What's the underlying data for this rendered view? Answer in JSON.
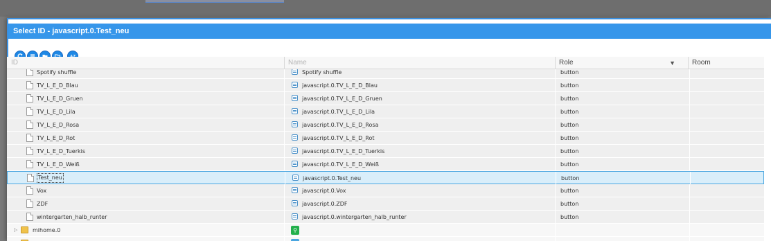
{
  "dialog": {
    "title": "Select ID - javascript.0.Test_neu"
  },
  "toolbar": {
    "buttons": [
      {
        "name": "refresh-icon",
        "glyph": "⟳"
      },
      {
        "name": "list-icon",
        "glyph": "≡"
      },
      {
        "name": "folder-icon",
        "glyph": "▬"
      },
      {
        "name": "folder-open-icon",
        "glyph": "▭"
      },
      {
        "name": "sort-az-icon",
        "glyph": "AZ"
      }
    ]
  },
  "table": {
    "columns": {
      "id": "ID",
      "name": "Name",
      "role": "Role",
      "room": "Room"
    },
    "rows": [
      {
        "id": "Spotify shuffle",
        "name": "Spotify shuffle",
        "role": "button",
        "selected": false
      },
      {
        "id": "TV_L_E_D_Blau",
        "name": "javascript.0.TV_L_E_D_Blau",
        "role": "button",
        "selected": false
      },
      {
        "id": "TV_L_E_D_Gruen",
        "name": "javascript.0.TV_L_E_D_Gruen",
        "role": "button",
        "selected": false
      },
      {
        "id": "TV_L_E_D_Lila",
        "name": "javascript.0.TV_L_E_D_Lila",
        "role": "button",
        "selected": false
      },
      {
        "id": "TV_L_E_D_Rosa",
        "name": "javascript.0.TV_L_E_D_Rosa",
        "role": "button",
        "selected": false
      },
      {
        "id": "TV_L_E_D_Rot",
        "name": "javascript.0.TV_L_E_D_Rot",
        "role": "button",
        "selected": false
      },
      {
        "id": "TV_L_E_D_Tuerkis",
        "name": "javascript.0.TV_L_E_D_Tuerkis",
        "role": "button",
        "selected": false
      },
      {
        "id": "TV_L_E_D_Weiß",
        "name": "javascript.0.TV_L_E_D_Weiß",
        "role": "button",
        "selected": false
      },
      {
        "id": "Test_neu",
        "name": "javascript.0.Test_neu",
        "role": "button",
        "selected": true
      },
      {
        "id": "Vox",
        "name": "javascript.0.Vox",
        "role": "button",
        "selected": false
      },
      {
        "id": "ZDF",
        "name": "javascript.0.ZDF",
        "role": "button",
        "selected": false
      },
      {
        "id": "wintergarten_halb_runter",
        "name": "javascript.0.wintergarten_halb_runter",
        "role": "button",
        "selected": false
      }
    ],
    "folders": [
      {
        "id": "mihome.0"
      },
      {
        "id": ""
      }
    ]
  },
  "colors": {
    "titlebar": "#3696ea",
    "selected_row": "#d9eefa",
    "row": "#efefef"
  }
}
